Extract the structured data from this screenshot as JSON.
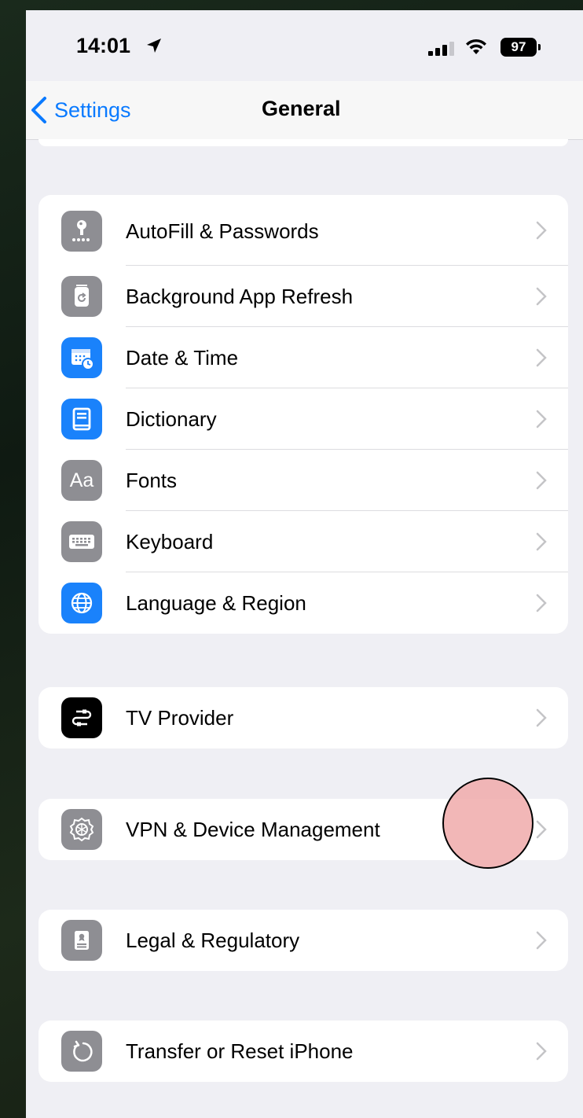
{
  "status_bar": {
    "time": "14:01",
    "battery": "97"
  },
  "nav": {
    "back_label": "Settings",
    "title": "General"
  },
  "groups": [
    {
      "items": [
        {
          "label": "AutoFill & Passwords",
          "icon": "key-icon",
          "icon_color": "#8e8e93"
        },
        {
          "label": "Background App Refresh",
          "icon": "refresh-icon",
          "icon_color": "#8e8e93"
        },
        {
          "label": "Date & Time",
          "icon": "calendar-clock-icon",
          "icon_color": "#1a82fb"
        },
        {
          "label": "Dictionary",
          "icon": "book-icon",
          "icon_color": "#1a82fb"
        },
        {
          "label": "Fonts",
          "icon": "fonts-icon",
          "icon_glyph": "Aa",
          "icon_color": "#8e8e93"
        },
        {
          "label": "Keyboard",
          "icon": "keyboard-icon",
          "icon_color": "#8e8e93"
        },
        {
          "label": "Language & Region",
          "icon": "globe-icon",
          "icon_color": "#1a82fb"
        }
      ]
    },
    {
      "items": [
        {
          "label": "TV Provider",
          "icon": "tv-provider-icon",
          "icon_color": "#000000"
        }
      ]
    },
    {
      "items": [
        {
          "label": "VPN & Device Management",
          "icon": "gear-icon",
          "icon_color": "#8e8e93"
        }
      ]
    },
    {
      "items": [
        {
          "label": "Legal & Regulatory",
          "icon": "document-icon",
          "icon_color": "#8e8e93"
        }
      ]
    },
    {
      "items": [
        {
          "label": "Transfer or Reset iPhone",
          "icon": "reset-icon",
          "icon_color": "#8e8e93"
        }
      ]
    }
  ],
  "colors": {
    "accent": "#0a7aff",
    "touch_indicator": "#f0aaaa"
  }
}
